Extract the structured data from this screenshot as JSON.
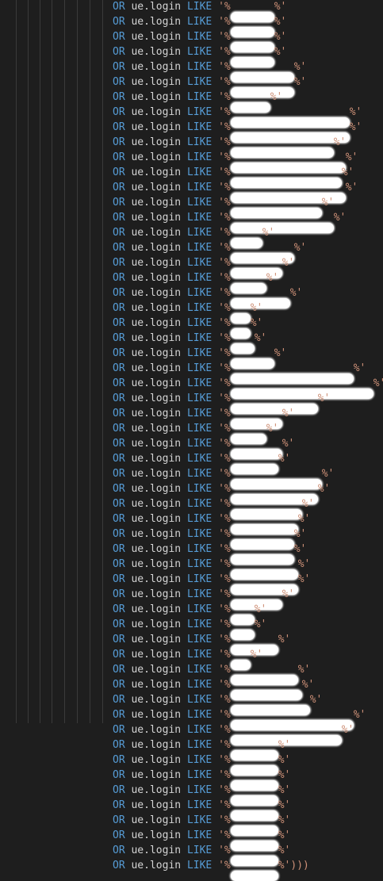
{
  "editor": {
    "theme": {
      "background": "#1e1e1e",
      "keyword": "#569cd6",
      "identifier": "#d4d4d4",
      "string": "#ce9178"
    },
    "lines": [
      {
        "or": "OR",
        "field": "ue.login",
        "like": "LIKE",
        "open": "'%",
        "close": "%'"
      },
      {
        "or": "OR",
        "field": "ue.login",
        "like": "LIKE",
        "open": "'%",
        "close": "%'"
      },
      {
        "or": "OR",
        "field": "ue.login",
        "like": "LIKE",
        "open": "'%",
        "close": "%'"
      },
      {
        "or": "OR",
        "field": "ue.login",
        "like": "LIKE",
        "open": "'%",
        "close": "%'"
      },
      {
        "or": "OR",
        "field": "ue.login",
        "like": "LIKE",
        "open": "'%",
        "close": "%'"
      },
      {
        "or": "OR",
        "field": "ue.login",
        "like": "LIKE",
        "open": "'%",
        "close": "%'"
      },
      {
        "or": "OR",
        "field": "ue.login",
        "like": "LIKE",
        "open": "'%",
        "close": "%'"
      },
      {
        "or": "OR",
        "field": "ue.login",
        "like": "LIKE",
        "open": "'%",
        "close": "%'"
      },
      {
        "or": "OR",
        "field": "ue.login",
        "like": "LIKE",
        "open": "'%",
        "close": "%'"
      },
      {
        "or": "OR",
        "field": "ue.login",
        "like": "LIKE",
        "open": "'%",
        "close": "%'"
      },
      {
        "or": "OR",
        "field": "ue.login",
        "like": "LIKE",
        "open": "'%",
        "close": "%'"
      },
      {
        "or": "OR",
        "field": "ue.login",
        "like": "LIKE",
        "open": "'%",
        "close": "%'"
      },
      {
        "or": "OR",
        "field": "ue.login",
        "like": "LIKE",
        "open": "'%",
        "close": "%'"
      },
      {
        "or": "OR",
        "field": "ue.login",
        "like": "LIKE",
        "open": "'%",
        "close": "%'"
      },
      {
        "or": "OR",
        "field": "ue.login",
        "like": "LIKE",
        "open": "'%",
        "close": "%'"
      },
      {
        "or": "OR",
        "field": "ue.login",
        "like": "LIKE",
        "open": "'%",
        "close": "%'"
      },
      {
        "or": "OR",
        "field": "ue.login",
        "like": "LIKE",
        "open": "'%",
        "close": "%'"
      },
      {
        "or": "OR",
        "field": "ue.login",
        "like": "LIKE",
        "open": "'%",
        "close": "%'"
      },
      {
        "or": "OR",
        "field": "ue.login",
        "like": "LIKE",
        "open": "'%",
        "close": "%'"
      },
      {
        "or": "OR",
        "field": "ue.login",
        "like": "LIKE",
        "open": "'%",
        "close": "%'"
      },
      {
        "or": "OR",
        "field": "ue.login",
        "like": "LIKE",
        "open": "'%",
        "close": "%'"
      },
      {
        "or": "OR",
        "field": "ue.login",
        "like": "LIKE",
        "open": "'%",
        "close": "%'"
      },
      {
        "or": "OR",
        "field": "ue.login",
        "like": "LIKE",
        "open": "'%",
        "close": "%'"
      },
      {
        "or": "OR",
        "field": "ue.login",
        "like": "LIKE",
        "open": "'%",
        "close": "%'"
      },
      {
        "or": "OR",
        "field": "ue.login",
        "like": "LIKE",
        "open": "'%",
        "close": "%'"
      },
      {
        "or": "OR",
        "field": "ue.login",
        "like": "LIKE",
        "open": "'%",
        "close": "%'"
      },
      {
        "or": "OR",
        "field": "ue.login",
        "like": "LIKE",
        "open": "'%",
        "close": "%'"
      },
      {
        "or": "OR",
        "field": "ue.login",
        "like": "LIKE",
        "open": "'%",
        "close": "%'"
      },
      {
        "or": "OR",
        "field": "ue.login",
        "like": "LIKE",
        "open": "'%",
        "close": "%'"
      },
      {
        "or": "OR",
        "field": "ue.login",
        "like": "LIKE",
        "open": "'%",
        "close": "%'"
      },
      {
        "or": "OR",
        "field": "ue.login",
        "like": "LIKE",
        "open": "'%",
        "close": "%'"
      },
      {
        "or": "OR",
        "field": "ue.login",
        "like": "LIKE",
        "open": "'%",
        "close": "%'"
      },
      {
        "or": "OR",
        "field": "ue.login",
        "like": "LIKE",
        "open": "'%",
        "close": "%'"
      },
      {
        "or": "OR",
        "field": "ue.login",
        "like": "LIKE",
        "open": "'%",
        "close": "%'"
      },
      {
        "or": "OR",
        "field": "ue.login",
        "like": "LIKE",
        "open": "'%",
        "close": "%'"
      },
      {
        "or": "OR",
        "field": "ue.login",
        "like": "LIKE",
        "open": "'%",
        "close": "%'"
      },
      {
        "or": "OR",
        "field": "ue.login",
        "like": "LIKE",
        "open": "'%",
        "close": "%'"
      },
      {
        "or": "OR",
        "field": "ue.login",
        "like": "LIKE",
        "open": "'%",
        "close": "%'"
      },
      {
        "or": "OR",
        "field": "ue.login",
        "like": "LIKE",
        "open": "'%",
        "close": "%'"
      },
      {
        "or": "OR",
        "field": "ue.login",
        "like": "LIKE",
        "open": "'%",
        "close": "%'"
      },
      {
        "or": "OR",
        "field": "ue.login",
        "like": "LIKE",
        "open": "'%",
        "close": "%'"
      },
      {
        "or": "OR",
        "field": "ue.login",
        "like": "LIKE",
        "open": "'%",
        "close": "%'"
      },
      {
        "or": "OR",
        "field": "ue.login",
        "like": "LIKE",
        "open": "'%",
        "close": "%'"
      },
      {
        "or": "OR",
        "field": "ue.login",
        "like": "LIKE",
        "open": "'%",
        "close": "%'"
      },
      {
        "or": "OR",
        "field": "ue.login",
        "like": "LIKE",
        "open": "'%",
        "close": "%'"
      },
      {
        "or": "OR",
        "field": "ue.login",
        "like": "LIKE",
        "open": "'%",
        "close": "%'"
      },
      {
        "or": "OR",
        "field": "ue.login",
        "like": "LIKE",
        "open": "'%",
        "close": "%'"
      },
      {
        "or": "OR",
        "field": "ue.login",
        "like": "LIKE",
        "open": "'%",
        "close": "%'"
      },
      {
        "or": "OR",
        "field": "ue.login",
        "like": "LIKE",
        "open": "'%",
        "close": "%'"
      },
      {
        "or": "OR",
        "field": "ue.login",
        "like": "LIKE",
        "open": "'%",
        "close": "%'"
      },
      {
        "or": "OR",
        "field": "ue.login",
        "like": "LIKE",
        "open": "'%",
        "close": "%'"
      },
      {
        "or": "OR",
        "field": "ue.login",
        "like": "LIKE",
        "open": "'%",
        "close": "%'"
      },
      {
        "or": "OR",
        "field": "ue.login",
        "like": "LIKE",
        "open": "'%",
        "close": "%'"
      },
      {
        "or": "OR",
        "field": "ue.login",
        "like": "LIKE",
        "open": "'%",
        "close": "%'"
      },
      {
        "or": "OR",
        "field": "ue.login",
        "like": "LIKE",
        "open": "'%",
        "close": "%'"
      },
      {
        "or": "OR",
        "field": "ue.login",
        "like": "LIKE",
        "open": "'%",
        "close": "%'"
      },
      {
        "or": "OR",
        "field": "ue.login",
        "like": "LIKE",
        "open": "'%",
        "close": "%'"
      },
      {
        "or": "OR",
        "field": "ue.login",
        "like": "LIKE",
        "open": "'%",
        "close": "%')))"
      }
    ]
  }
}
